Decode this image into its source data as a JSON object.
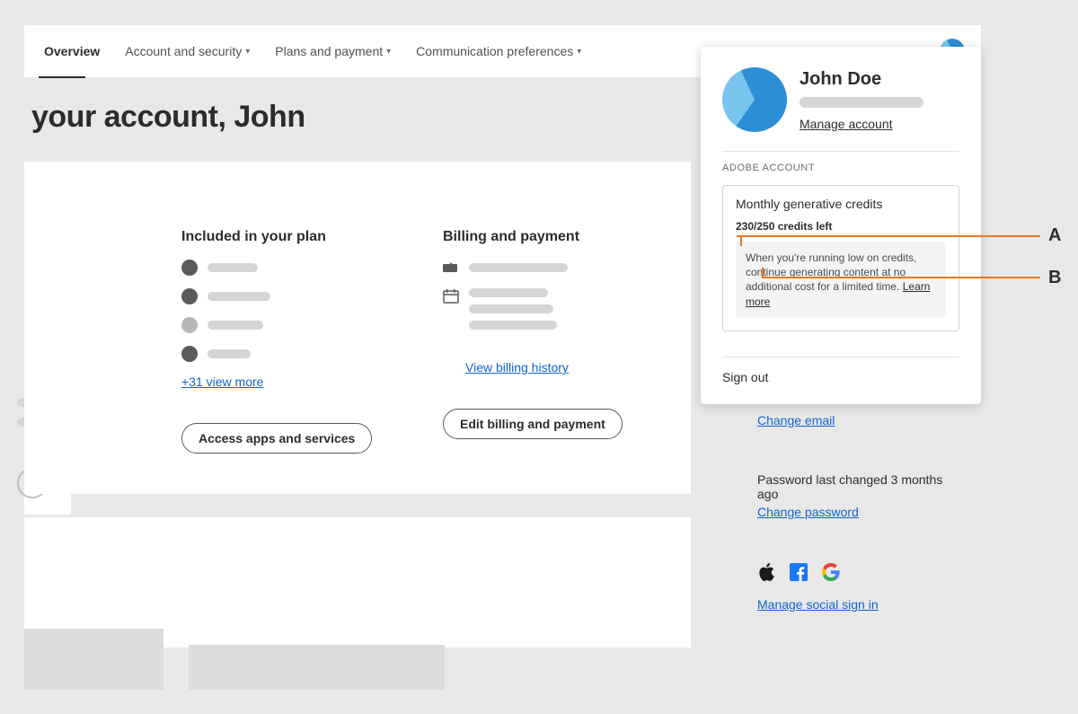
{
  "nav": {
    "tabs": [
      "Overview",
      "Account and security",
      "Plans and payment",
      "Communication preferences"
    ]
  },
  "page_title": "your account, John",
  "plan_col": {
    "title": "Included in your plan",
    "view_more": "+31 view more",
    "button": "Access apps and services"
  },
  "billing_col": {
    "title": "Billing and payment",
    "history_link": "View billing history",
    "button": "Edit billing and payment"
  },
  "popup": {
    "name": "John Doe",
    "manage": "Manage account",
    "section": "ADOBE ACCOUNT",
    "credits_title": "Monthly generative credits",
    "credits_sub": "230/250 credits left",
    "credits_note": "When you're running low on credits, continue generating content at no additional cost for a limited time. ",
    "learn_more": "Learn more",
    "signout": "Sign out"
  },
  "right_col": {
    "change_email": "Change email",
    "pwd_text": "Password last changed 3 months ago",
    "change_pwd": "Change password",
    "manage_social": "Manage social sign in"
  },
  "callouts": {
    "A": "A",
    "B": "B"
  }
}
